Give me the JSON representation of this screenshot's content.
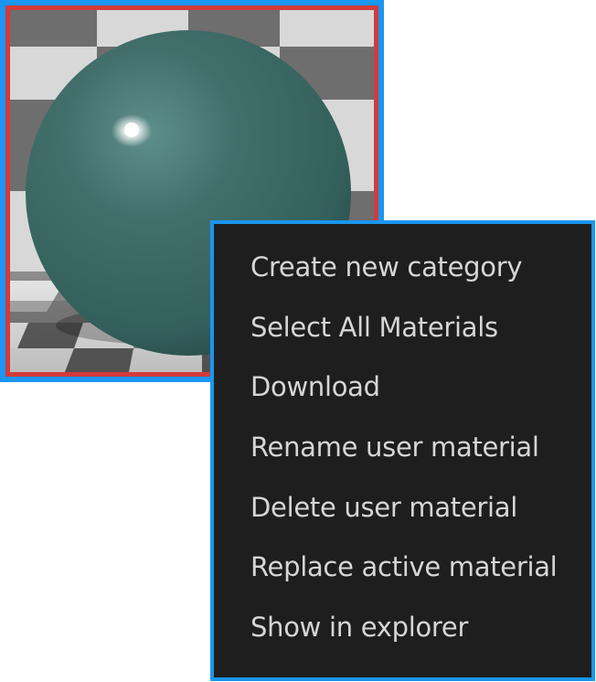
{
  "material_thumbnail": {
    "sphere_color": "#3d6b67",
    "selection_border_color": "#d23b3b",
    "focus_border_color": "#1a96f0"
  },
  "context_menu": {
    "background": "#1e1e1e",
    "text_color": "#d6d6d6",
    "items": [
      {
        "label": "Create new category"
      },
      {
        "label": "Select All Materials"
      },
      {
        "label": "Download"
      },
      {
        "label": "Rename user material"
      },
      {
        "label": "Delete user material"
      },
      {
        "label": "Replace active material"
      },
      {
        "label": "Show in explorer"
      }
    ]
  }
}
